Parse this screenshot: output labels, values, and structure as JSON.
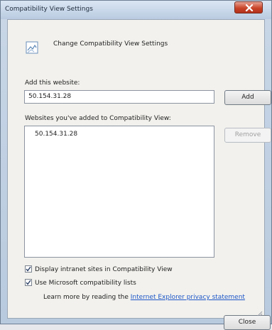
{
  "window": {
    "title": "Compatibility View Settings",
    "close_icon": "close-x-icon",
    "accent_color": "#c9452a"
  },
  "header": {
    "icon": "page-icon",
    "text": "Change Compatibility View Settings"
  },
  "add_section": {
    "label": "Add this website:",
    "input_value": "50.154.31.28",
    "add_button": "Add"
  },
  "list_section": {
    "label": "Websites you've added to Compatibility View:",
    "items": [
      "50.154.31.28"
    ],
    "remove_button": "Remove"
  },
  "options": {
    "intranet": {
      "label": "Display intranet sites in Compatibility View",
      "checked": true
    },
    "microsoft_lists": {
      "label": "Use Microsoft compatibility lists",
      "checked": true
    }
  },
  "learn_more": {
    "prefix": "Learn more by reading the ",
    "link": "Internet Explorer privacy statement"
  },
  "footer": {
    "close_button": "Close"
  }
}
